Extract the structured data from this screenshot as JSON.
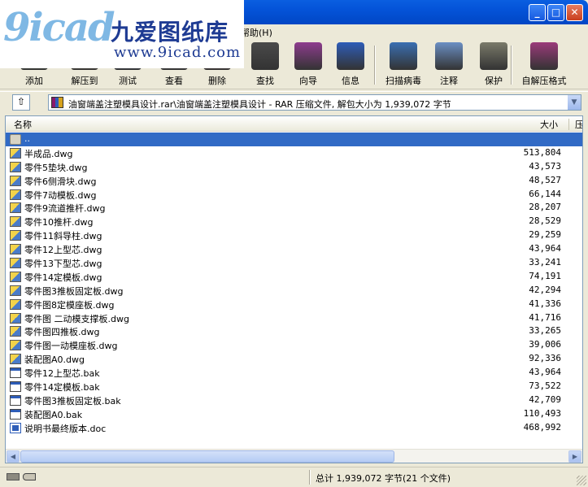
{
  "logo": {
    "big": "9icad",
    "cn": "九爱图纸库",
    "url": "www.9icad.com"
  },
  "window": {
    "min_glyph": "_",
    "max_glyph": "□",
    "close_glyph": "✕"
  },
  "menu": {
    "help": "帮助(H)"
  },
  "toolbar": {
    "buttons": [
      {
        "label": "添加",
        "icon": "add-icon",
        "color": "#5B8C2A"
      },
      {
        "label": "解压到",
        "icon": "extract-icon",
        "color": "#C48A1C"
      },
      {
        "label": "测试",
        "icon": "test-icon",
        "color": "#3E74C2"
      },
      {
        "label": "查看",
        "icon": "view-icon",
        "color": "#6E6A5A"
      },
      {
        "label": "删除",
        "icon": "delete-icon",
        "color": "#B33A2A"
      },
      {
        "label": "查找",
        "icon": "find-icon",
        "color": "#4A4A4A"
      },
      {
        "label": "向导",
        "icon": "wizard-icon",
        "color": "#8E3C8E"
      },
      {
        "label": "信息",
        "icon": "info-icon",
        "color": "#2E5DB8"
      },
      {
        "label": "扫描病毒",
        "icon": "virus-scan-icon",
        "color": "#3A6FB2"
      },
      {
        "label": "注释",
        "icon": "comment-icon",
        "color": "#6B8FC4"
      },
      {
        "label": "保护",
        "icon": "protect-icon",
        "color": "#7A7A6A"
      },
      {
        "label": "自解压格式",
        "icon": "sfx-icon",
        "color": "#9B3A7A"
      }
    ]
  },
  "address": {
    "up_glyph": "⇧",
    "path": "油窗端盖注塑模具设计.rar\\油窗端盖注塑模具设计 - RAR 压缩文件, 解包大小为 1,939,072 字节",
    "dropdown_glyph": "▼"
  },
  "columns": {
    "name": "名称",
    "size": "大小",
    "extra": "压"
  },
  "files": [
    {
      "name": "..",
      "size": "",
      "type": "folder",
      "selected": true
    },
    {
      "name": "半成品.dwg",
      "size": "513,804",
      "type": "dwg"
    },
    {
      "name": "零件5垫块.dwg",
      "size": "43,573",
      "type": "dwg"
    },
    {
      "name": "零件6侧滑块.dwg",
      "size": "48,527",
      "type": "dwg"
    },
    {
      "name": "零件7动模板.dwg",
      "size": "66,144",
      "type": "dwg"
    },
    {
      "name": "零件9流道推杆.dwg",
      "size": "28,207",
      "type": "dwg"
    },
    {
      "name": "零件10推杆.dwg",
      "size": "28,529",
      "type": "dwg"
    },
    {
      "name": "零件11斜导柱.dwg",
      "size": "29,259",
      "type": "dwg"
    },
    {
      "name": "零件12上型芯.dwg",
      "size": "43,964",
      "type": "dwg"
    },
    {
      "name": "零件13下型芯.dwg",
      "size": "33,241",
      "type": "dwg"
    },
    {
      "name": "零件14定模板.dwg",
      "size": "74,191",
      "type": "dwg"
    },
    {
      "name": "零件图3推板固定板.dwg",
      "size": "42,294",
      "type": "dwg"
    },
    {
      "name": "零件图8定模座板.dwg",
      "size": "41,336",
      "type": "dwg"
    },
    {
      "name": "零件图 二动模支撑板.dwg",
      "size": "41,716",
      "type": "dwg"
    },
    {
      "name": "零件图四推板.dwg",
      "size": "33,265",
      "type": "dwg"
    },
    {
      "name": "零件图一动模座板.dwg",
      "size": "39,006",
      "type": "dwg"
    },
    {
      "name": "装配图A0.dwg",
      "size": "92,336",
      "type": "dwg"
    },
    {
      "name": "零件12上型芯.bak",
      "size": "43,964",
      "type": "bak"
    },
    {
      "name": "零件14定模板.bak",
      "size": "73,522",
      "type": "bak"
    },
    {
      "name": "零件图3推板固定板.bak",
      "size": "42,709",
      "type": "bak"
    },
    {
      "name": "装配图A0.bak",
      "size": "110,493",
      "type": "bak"
    },
    {
      "name": "说明书最终版本.doc",
      "size": "468,992",
      "type": "doc"
    }
  ],
  "scroll": {
    "left_glyph": "◀",
    "right_glyph": "▶"
  },
  "status": {
    "total": "总计 1,939,072 字节(21 个文件)"
  }
}
